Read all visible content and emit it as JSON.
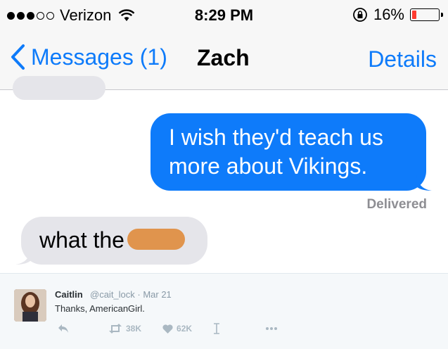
{
  "status_bar": {
    "carrier": "Verizon",
    "time": "8:29 PM",
    "battery": "16%",
    "battery_level": 0.16,
    "signal_icon": "signal-dots-icon",
    "wifi_icon": "wifi-icon",
    "rotation_lock_icon": "rotation-lock-icon"
  },
  "nav": {
    "back_label": "Messages (1)",
    "title": "Zach",
    "details_label": "Details"
  },
  "messages": [
    {
      "direction": "outgoing",
      "text": "I wish they'd teach us more about Vikings."
    },
    {
      "direction": "incoming",
      "text": "what the f"
    }
  ],
  "delivered_label": "Delivered",
  "tweet": {
    "name": "Caitlin",
    "handle": "@cait_lock · Mar 21",
    "text": "Thanks, AmericanGirl.",
    "retweets": "38K",
    "likes": "62K"
  },
  "colors": {
    "ios_blue": "#0e7bfa",
    "incoming_bubble": "#e5e5ea",
    "battery_low": "#ff3b30",
    "redaction": "#e0944d"
  }
}
